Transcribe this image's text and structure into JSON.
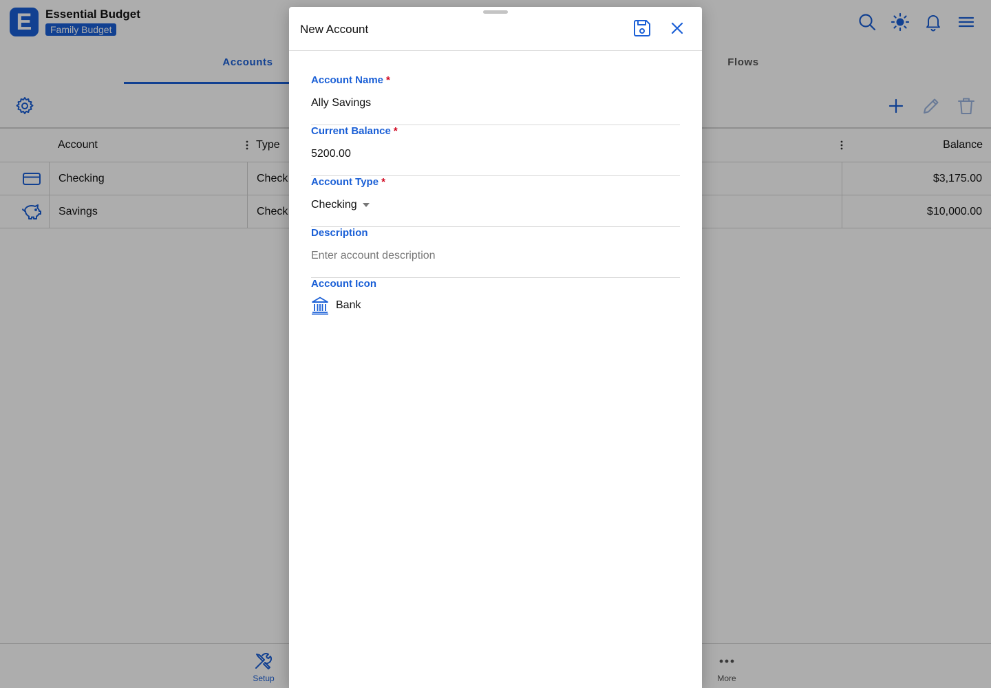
{
  "app": {
    "title": "Essential Budget",
    "budget_name": "Family Budget",
    "logo_letter": "E"
  },
  "header_icons": [
    "search-icon",
    "brightness-icon",
    "bell-icon",
    "menu-icon"
  ],
  "tabs": [
    {
      "label": "Accounts",
      "active": true
    },
    {
      "label": "Flows",
      "active": false
    }
  ],
  "grid": {
    "columns": [
      "Account",
      "Type",
      "Balance"
    ],
    "rows": [
      {
        "icon": "credit-card-icon",
        "account": "Checking",
        "type": "Check",
        "balance": "$3,175.00"
      },
      {
        "icon": "piggy-bank-icon",
        "account": "Savings",
        "type": "Check",
        "balance": "$10,000.00"
      }
    ]
  },
  "bottom_nav": [
    {
      "label": "Setup",
      "icon": "tools-icon",
      "active": true
    },
    {
      "label": "More",
      "icon": "more-icon",
      "active": false
    }
  ],
  "modal": {
    "title": "New Account",
    "fields": {
      "account_name": {
        "label": "Account Name",
        "required_mark": "*",
        "value": "Ally Savings"
      },
      "current_balance": {
        "label": "Current Balance",
        "required_mark": "*",
        "value": "5200.00"
      },
      "account_type": {
        "label": "Account Type",
        "required_mark": "*",
        "value": "Checking"
      },
      "description": {
        "label": "Description",
        "value": "",
        "placeholder": "Enter account description"
      },
      "account_icon": {
        "label": "Account Icon",
        "value": "Bank",
        "icon": "bank-icon"
      }
    }
  },
  "colors": {
    "accent": "#1a5fd6",
    "required": "#d0021b"
  }
}
